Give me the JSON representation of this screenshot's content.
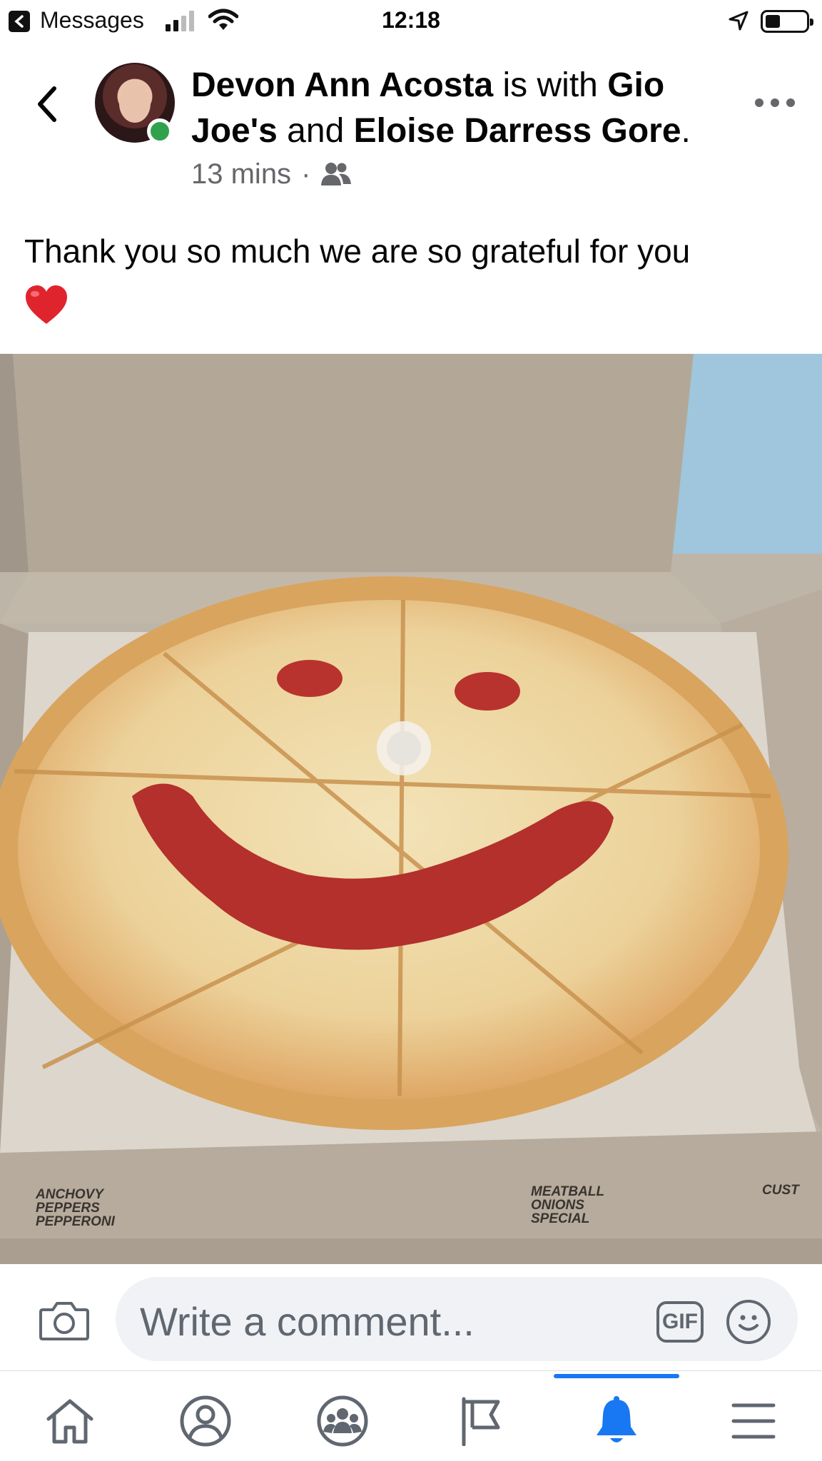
{
  "status_bar": {
    "back_app": "Messages",
    "time": "12:18",
    "battery_level": 0.35
  },
  "post": {
    "author": "Devon Ann Acosta",
    "with_text": "is with",
    "tagged_1": "Gio Joe's",
    "and_text": "and",
    "tagged_2": "Eloise Darress Gore",
    "period": ".",
    "time": "13 mins",
    "separator": "·",
    "audience_icon": "friends-icon",
    "text": "Thank you so much we are so grateful for you",
    "emoji": "heart-icon",
    "box_print_left": [
      "ANCHOVY",
      "PEPPERS",
      "PEPPERONI"
    ],
    "box_print_right": [
      "MEATBALL",
      "ONIONS",
      "SPECIAL"
    ],
    "box_print_edge": "CUST"
  },
  "comment_bar": {
    "placeholder": "Write a comment...",
    "gif_label": "GIF"
  },
  "nav": {
    "items": [
      "home-icon",
      "profile-icon",
      "groups-icon",
      "pages-icon",
      "notifications-icon",
      "menu-icon"
    ],
    "active": "notifications-icon",
    "accent": "#1877f2"
  },
  "colors": {
    "online": "#31a24c",
    "secondary_text": "#65676b"
  }
}
